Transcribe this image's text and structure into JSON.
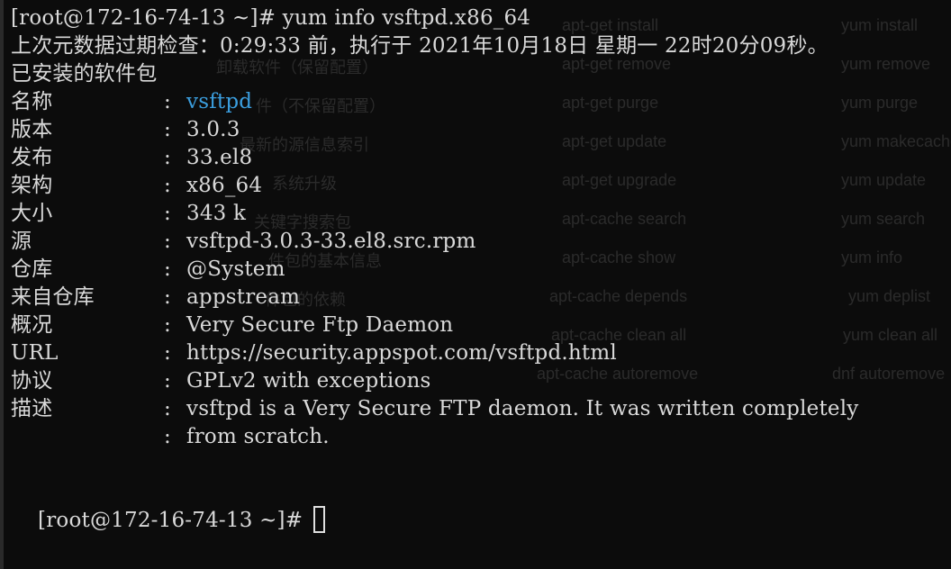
{
  "terminal": {
    "command_prompt": "[root@172-16-74-13 ~]# yum info vsftpd.x86_64",
    "metadata_line": "上次元数据过期检查：0:29:33 前，执行于 2021年10月18日 星期一 22时20分09秒。",
    "section_title": "已安装的软件包",
    "fields": [
      {
        "key": "名称",
        "value": "vsftpd"
      },
      {
        "key": "版本",
        "value": "3.0.3"
      },
      {
        "key": "发布",
        "value": "33.el8"
      },
      {
        "key": "架构",
        "value": "x86_64"
      },
      {
        "key": "大小",
        "value": "343 k"
      },
      {
        "key": "源",
        "value": "vsftpd-3.0.3-33.el8.src.rpm"
      },
      {
        "key": "仓库",
        "value": "@System"
      },
      {
        "key": "来自仓库",
        "value": "appstream"
      },
      {
        "key": "概况",
        "value": "Very Secure Ftp Daemon"
      },
      {
        "key": "URL",
        "value": "https://security.appspot.com/vsftpd.html"
      },
      {
        "key": "协议",
        "value": "GPLv2 with exceptions"
      },
      {
        "key": "描述",
        "value": "vsftpd is a Very Secure FTP daemon. It was written completely"
      },
      {
        "key": "",
        "value": "from scratch."
      }
    ],
    "colon": ":",
    "final_prompt": "[root@172-16-74-13 ~]# ",
    "colors": {
      "background": "#0c0c0c",
      "text": "#d9d9d9",
      "package_name": "#3b9ede"
    }
  },
  "ghost_overlay": {
    "rows": [
      {
        "c1": "",
        "c2": "apt-get install",
        "c3": "yum install"
      },
      {
        "c1": "卸载软件（保留配置）",
        "c2": "apt-get remove",
        "c3": "yum remove"
      },
      {
        "c1": "件（不保留配置）",
        "c2": "apt-get purge",
        "c3": "yum purge"
      },
      {
        "c1": "最新的源信息索引",
        "c2": "apt-get update",
        "c3": "yum makecache"
      },
      {
        "c1": "系统升级",
        "c2": "apt-get upgrade",
        "c3": "yum update"
      },
      {
        "c1": "关键字搜索包",
        "c2": "apt-cache search",
        "c3": "yum search"
      },
      {
        "c1": "件包的基本信息",
        "c2": "apt-cache show",
        "c3": "yum info"
      },
      {
        "c1": "件包的依赖",
        "c2": "apt-cache depends",
        "c3": "yum deplist"
      },
      {
        "c1": "",
        "c2": "apt-cache clean all",
        "c3": "yum clean all"
      },
      {
        "c1": "",
        "c2": "apt-cache autoremove",
        "c3": "dnf autoremove"
      }
    ]
  }
}
